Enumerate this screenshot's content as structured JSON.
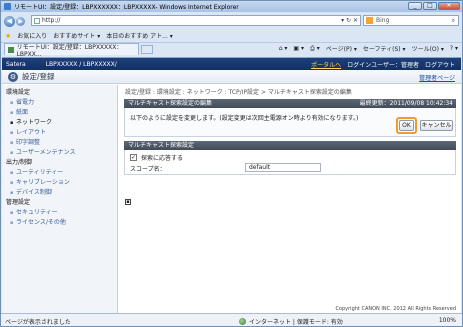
{
  "browser": {
    "title": "リモートUI：設定/登録：LBPXXXXXX：LBPXXXXX- Windows Internet Explorer",
    "url": "http://",
    "search_placeholder": "Bing",
    "favorites_label": "お気に入り",
    "suggested_sites": "おすすめサイト ▾",
    "web_slice": "本日のおすすめ アト... ▾",
    "tab_label": "リモートUI：設定/登録：LBPXXXXX：LBPXX...",
    "cmd_page": "ページ(P) ▾",
    "cmd_safety": "セーフティ(S) ▾",
    "cmd_tools": "ツール(O) ▾",
    "status_text": "ページが表示されました",
    "zone_text": "インターネット | 保護モード: 有効",
    "zoom_text": "100%"
  },
  "brandbar": {
    "brand": "Satera",
    "device": "LBPXXXXX / LBPXXXXX/",
    "portal": "ポータルへ",
    "login_user": "ログインユーザー：管理者",
    "logout": "ログアウト"
  },
  "header": {
    "title": "設定/登録",
    "mgmt_link": "管理者ページ"
  },
  "sidebar": {
    "group1": "環境設定",
    "items1": [
      "省電力",
      "紙面",
      "ネットワーク",
      "レイアウト",
      "印字調整",
      "ユーザーメンテナンス"
    ],
    "group2": "出力/制御",
    "items2": [
      "ユーティリティー",
      "キャリブレーション",
      "デバイス制御"
    ],
    "group3": "管理設定",
    "items3": [
      "セキュリティー",
      "ライセンス/その他"
    ]
  },
  "main": {
    "breadcrumb": "設定/登録 : 環境設定 : ネットワーク : TCP/IP設定 > マルチキャスト探索設定の編集",
    "section_title": "マルチキャスト探索設定の編集",
    "last_updated": "最終更新：2011/09/08 10:42:34",
    "confirm_message": "以下のように設定を変更します。(設定変更は次回主電源オン時より有効になります。)",
    "ok_label": "OK",
    "cancel_label": "キャンセル",
    "settings_title": "マルチキャスト探索設定",
    "checkbox_label": "探索に応答する",
    "scope_label": "スコープ名：",
    "scope_value": "default",
    "copyright": "Copyright CANON INC. 2012 All Rights Reserved"
  },
  "colors": {
    "highlight": "#f39a2a",
    "brandbar": "#1e3f7a",
    "section_head": "#4a5563"
  }
}
